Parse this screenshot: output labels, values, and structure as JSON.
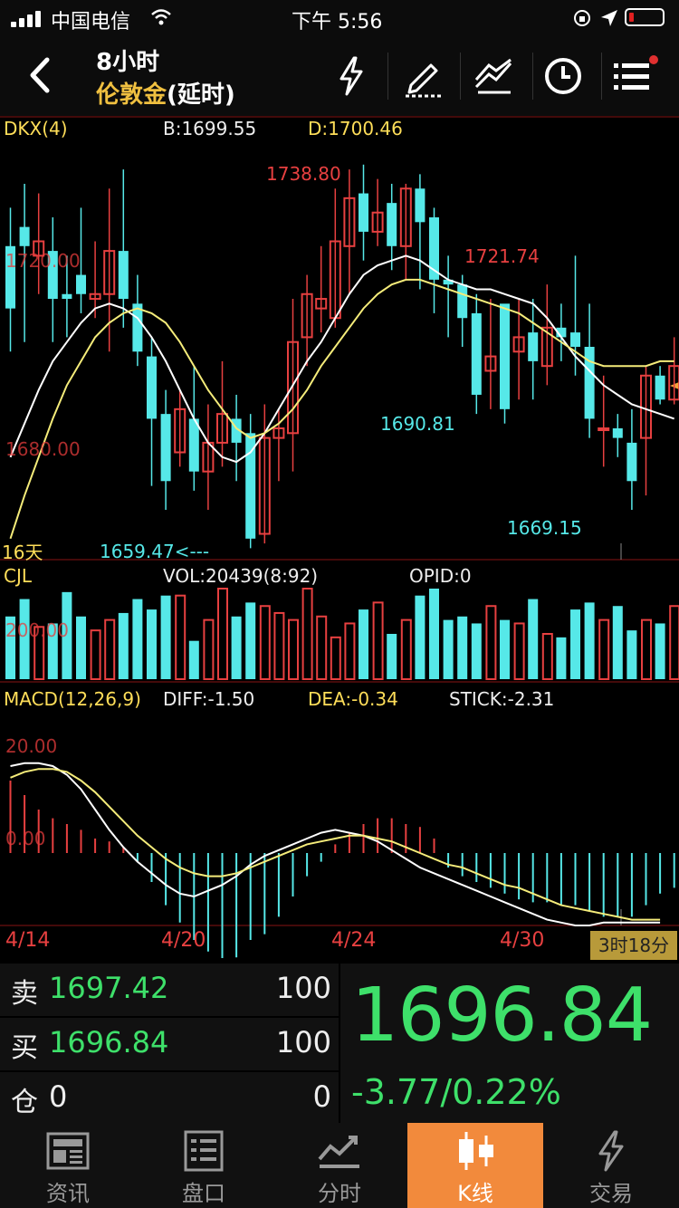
{
  "status": {
    "carrier": "中国电信",
    "time": "下午 5:56"
  },
  "nav": {
    "period": "8小时",
    "instrument": "伦敦金",
    "instrument_suffix": "(延时)"
  },
  "kline": {
    "indicator": "DKX(4)",
    "b_value": "B:1699.55",
    "d_value": "D:1700.46",
    "high_marker": "1738.80",
    "level_high": "1720.00",
    "level_mid_marker": "1721.74",
    "low_mid_marker": "1690.81",
    "level_low": "1680.00",
    "low_marker": "1669.15",
    "low_left_marker": "1659.47<---",
    "period_label": "16天"
  },
  "volume": {
    "label": "CJL",
    "vol": "VOL:20439(8:92)",
    "opid": "OPID:0",
    "level": "200.00"
  },
  "macd": {
    "label": "MACD(12,26,9)",
    "diff": "DIFF:-1.50",
    "dea": "DEA:-0.34",
    "stick": "STICK:-2.31",
    "level_20": "20.00",
    "level_0": "0.00"
  },
  "dates": [
    "4/14",
    "4/20",
    "4/24",
    "4/30"
  ],
  "countdown": "3时18分",
  "quote": {
    "sell_label": "卖",
    "sell_price": "1697.42",
    "sell_vol": "100",
    "buy_label": "买",
    "buy_price": "1696.84",
    "buy_vol": "100",
    "pos_label": "仓",
    "pos_value": "0",
    "pos_vol": "0",
    "last": "1696.84",
    "change": "-3.77/0.22%"
  },
  "tabs": [
    {
      "label": "资讯",
      "icon": "news-icon"
    },
    {
      "label": "盘口",
      "icon": "orderbook-icon"
    },
    {
      "label": "分时",
      "icon": "timeshare-icon"
    },
    {
      "label": "K线",
      "icon": "candlestick-icon"
    },
    {
      "label": "交易",
      "icon": "trade-icon"
    }
  ],
  "colors": {
    "up": "#e74040",
    "down": "#56e8e8",
    "price_down": "#3ee06a",
    "accent": "#f28a3c"
  },
  "chart_data": {
    "type": "candlestick",
    "title": "",
    "price_range": [
      1657,
      1745
    ],
    "candles": [
      [
        1722,
        1709,
        1730,
        1700
      ],
      [
        1726,
        1722,
        1735,
        1702
      ],
      [
        1720,
        1723,
        1733,
        1712
      ],
      [
        1721,
        1711,
        1728,
        1702
      ],
      [
        1712,
        1711,
        1720,
        1703
      ],
      [
        1716,
        1712,
        1730,
        1708
      ],
      [
        1711,
        1712,
        1723,
        1707
      ],
      [
        1712,
        1721,
        1734,
        1700
      ],
      [
        1721,
        1711,
        1738,
        1705
      ],
      [
        1710,
        1700,
        1716,
        1697
      ],
      [
        1699,
        1686,
        1703,
        1672
      ],
      [
        1687,
        1673,
        1692,
        1667
      ],
      [
        1679,
        1688,
        1692,
        1676
      ],
      [
        1686,
        1675,
        1697,
        1671
      ],
      [
        1675,
        1681,
        1689,
        1667
      ],
      [
        1681,
        1687,
        1698,
        1676
      ],
      [
        1686,
        1681,
        1691,
        1673
      ],
      [
        1683,
        1661,
        1687,
        1659
      ],
      [
        1662,
        1682,
        1689,
        1660
      ],
      [
        1682,
        1684,
        1688,
        1673
      ],
      [
        1683,
        1702,
        1711,
        1675
      ],
      [
        1703,
        1712,
        1716,
        1697
      ],
      [
        1709,
        1711,
        1722,
        1704
      ],
      [
        1707,
        1723,
        1734,
        1705
      ],
      [
        1722,
        1732,
        1738,
        1712
      ],
      [
        1733,
        1725,
        1739,
        1719
      ],
      [
        1725,
        1729,
        1736,
        1722
      ],
      [
        1731,
        1722,
        1735,
        1717
      ],
      [
        1722,
        1734,
        1735,
        1715
      ],
      [
        1734,
        1727,
        1737,
        1713
      ],
      [
        1728,
        1715,
        1730,
        1708
      ],
      [
        1715,
        1714,
        1720,
        1703
      ],
      [
        1714,
        1707,
        1716,
        1701
      ],
      [
        1708,
        1691,
        1712,
        1687
      ],
      [
        1696,
        1699,
        1711,
        1688
      ],
      [
        1710,
        1688,
        1708,
        1685
      ],
      [
        1700,
        1703,
        1711,
        1690
      ],
      [
        1704,
        1698,
        1711,
        1690
      ],
      [
        1697,
        1705,
        1714,
        1693
      ],
      [
        1705,
        1703,
        1710,
        1698
      ],
      [
        1704,
        1701,
        1720,
        1695
      ],
      [
        1701,
        1686,
        1710,
        1682
      ],
      [
        1684,
        1684,
        1695,
        1676
      ],
      [
        1684,
        1682,
        1687,
        1678
      ],
      [
        1681,
        1673,
        1688,
        1667
      ],
      [
        1682,
        1695,
        1697,
        1670
      ],
      [
        1695,
        1690,
        1697,
        1689
      ],
      [
        1690,
        1697,
        1703,
        1689
      ],
      [
        1697,
        1693,
        1707,
        1692
      ],
      [
        1694,
        1693,
        1700,
        1688
      ],
      [
        1694,
        1690,
        1699,
        1685
      ]
    ],
    "volume": [
      180,
      230,
      150,
      160,
      250,
      180,
      140,
      170,
      190,
      230,
      200,
      240,
      240,
      110,
      170,
      260,
      180,
      220,
      210,
      190,
      170,
      260,
      180,
      120,
      160,
      200,
      220,
      130,
      170,
      240,
      260,
      170,
      180,
      160,
      210,
      170,
      160,
      230,
      130,
      120,
      200,
      220,
      170,
      210,
      140,
      170,
      160,
      210,
      240,
      110,
      160
    ],
    "macd_hist": [
      25,
      20,
      15,
      12,
      10,
      8,
      5,
      4,
      2,
      -3,
      -10,
      -18,
      -24,
      -30,
      -34,
      -38,
      -36,
      -30,
      -28,
      -22,
      -15,
      -8,
      -3,
      3,
      7,
      10,
      12,
      12,
      10,
      9,
      5,
      -5,
      -8,
      -10,
      -12,
      -14,
      -16,
      -17,
      -17,
      -18,
      -18,
      -20,
      -22,
      -22,
      -22,
      -18,
      -14,
      -12,
      -9,
      -6,
      -4
    ],
    "dkx_white": [
      1678,
      1685,
      1692,
      1698,
      1702,
      1706,
      1709,
      1710,
      1709,
      1707,
      1703,
      1698,
      1692,
      1686,
      1681,
      1678,
      1677,
      1679,
      1683,
      1688,
      1693,
      1698,
      1702,
      1707,
      1712,
      1716,
      1718,
      1719,
      1720,
      1719,
      1717,
      1715,
      1714,
      1713,
      1713,
      1712,
      1711,
      1710,
      1707,
      1703,
      1699,
      1696,
      1693,
      1691,
      1689,
      1688,
      1687,
      1686
    ],
    "dkx_yellow": [
      1661,
      1670,
      1678,
      1686,
      1693,
      1698,
      1703,
      1706,
      1708,
      1709,
      1708,
      1706,
      1702,
      1697,
      1692,
      1688,
      1684,
      1682,
      1683,
      1685,
      1688,
      1692,
      1697,
      1701,
      1705,
      1709,
      1712,
      1714,
      1715,
      1715,
      1714,
      1713,
      1712,
      1711,
      1710,
      1709,
      1708,
      1706,
      1704,
      1702,
      1700,
      1698,
      1697,
      1697,
      1697,
      1697,
      1698,
      1698
    ],
    "macd_diff": [
      30,
      31,
      31,
      30,
      27,
      22,
      15,
      8,
      2,
      -3,
      -7,
      -11,
      -14,
      -15,
      -13,
      -11,
      -8,
      -4,
      -1,
      1,
      3,
      5,
      7,
      8,
      7,
      6,
      4,
      1,
      -2,
      -5,
      -7,
      -9,
      -11,
      -13,
      -15,
      -17,
      -19,
      -21,
      -23,
      -24,
      -25,
      -25,
      -24,
      -24,
      -24,
      -24,
      -24
    ],
    "macd_dea": [
      26,
      28,
      29,
      29,
      28,
      25,
      21,
      16,
      11,
      6,
      2,
      -2,
      -5,
      -7,
      -8,
      -8,
      -7,
      -5,
      -3,
      -1,
      1,
      3,
      4,
      5,
      6,
      6,
      5,
      4,
      2,
      0,
      -2,
      -4,
      -5,
      -7,
      -9,
      -11,
      -12,
      -14,
      -16,
      -18,
      -19,
      -20,
      -21,
      -22,
      -23,
      -23,
      -23
    ]
  }
}
